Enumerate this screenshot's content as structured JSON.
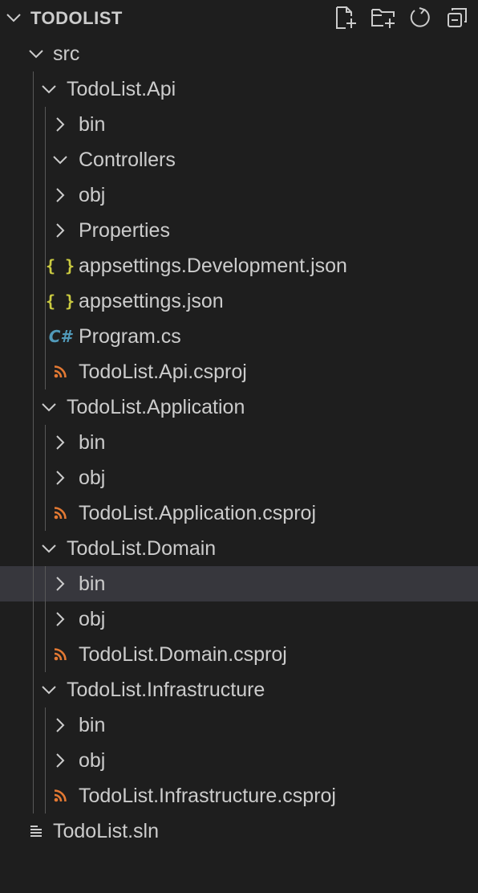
{
  "explorer": {
    "title": "TODOLIST",
    "actions": [
      {
        "name": "new-file-icon"
      },
      {
        "name": "new-folder-icon"
      },
      {
        "name": "refresh-icon"
      },
      {
        "name": "collapse-all-icon"
      }
    ]
  },
  "tree": {
    "items": [
      {
        "label": "src",
        "type": "folder",
        "expanded": true,
        "depth": 1
      },
      {
        "label": "TodoList.Api",
        "type": "folder",
        "expanded": true,
        "depth": 2
      },
      {
        "label": "bin",
        "type": "folder",
        "expanded": false,
        "depth": 3
      },
      {
        "label": "Controllers",
        "type": "folder",
        "expanded": true,
        "depth": 3
      },
      {
        "label": "obj",
        "type": "folder",
        "expanded": false,
        "depth": 3
      },
      {
        "label": "Properties",
        "type": "folder",
        "expanded": false,
        "depth": 3
      },
      {
        "label": "appsettings.Development.json",
        "type": "json",
        "depth": 3
      },
      {
        "label": "appsettings.json",
        "type": "json",
        "depth": 3
      },
      {
        "label": "Program.cs",
        "type": "csharp",
        "depth": 3
      },
      {
        "label": "TodoList.Api.csproj",
        "type": "csproj",
        "depth": 3
      },
      {
        "label": "TodoList.Application",
        "type": "folder",
        "expanded": true,
        "depth": 2
      },
      {
        "label": "bin",
        "type": "folder",
        "expanded": false,
        "depth": 3
      },
      {
        "label": "obj",
        "type": "folder",
        "expanded": false,
        "depth": 3
      },
      {
        "label": "TodoList.Application.csproj",
        "type": "csproj",
        "depth": 3
      },
      {
        "label": "TodoList.Domain",
        "type": "folder",
        "expanded": true,
        "depth": 2
      },
      {
        "label": "bin",
        "type": "folder",
        "expanded": false,
        "depth": 3,
        "selected": true
      },
      {
        "label": "obj",
        "type": "folder",
        "expanded": false,
        "depth": 3
      },
      {
        "label": "TodoList.Domain.csproj",
        "type": "csproj",
        "depth": 3
      },
      {
        "label": "TodoList.Infrastructure",
        "type": "folder",
        "expanded": true,
        "depth": 2
      },
      {
        "label": "bin",
        "type": "folder",
        "expanded": false,
        "depth": 3
      },
      {
        "label": "obj",
        "type": "folder",
        "expanded": false,
        "depth": 3
      },
      {
        "label": "TodoList.Infrastructure.csproj",
        "type": "csproj",
        "depth": 3
      },
      {
        "label": "TodoList.sln",
        "type": "sln",
        "depth": 2
      }
    ]
  },
  "colors": {
    "background": "#1e1e1e",
    "text": "#cccccc",
    "selection": "#37373d",
    "indent_guide": "#585858",
    "json_icon": "#cbcb41",
    "csharp_icon": "#519aba",
    "rss_icon": "#e37933"
  }
}
